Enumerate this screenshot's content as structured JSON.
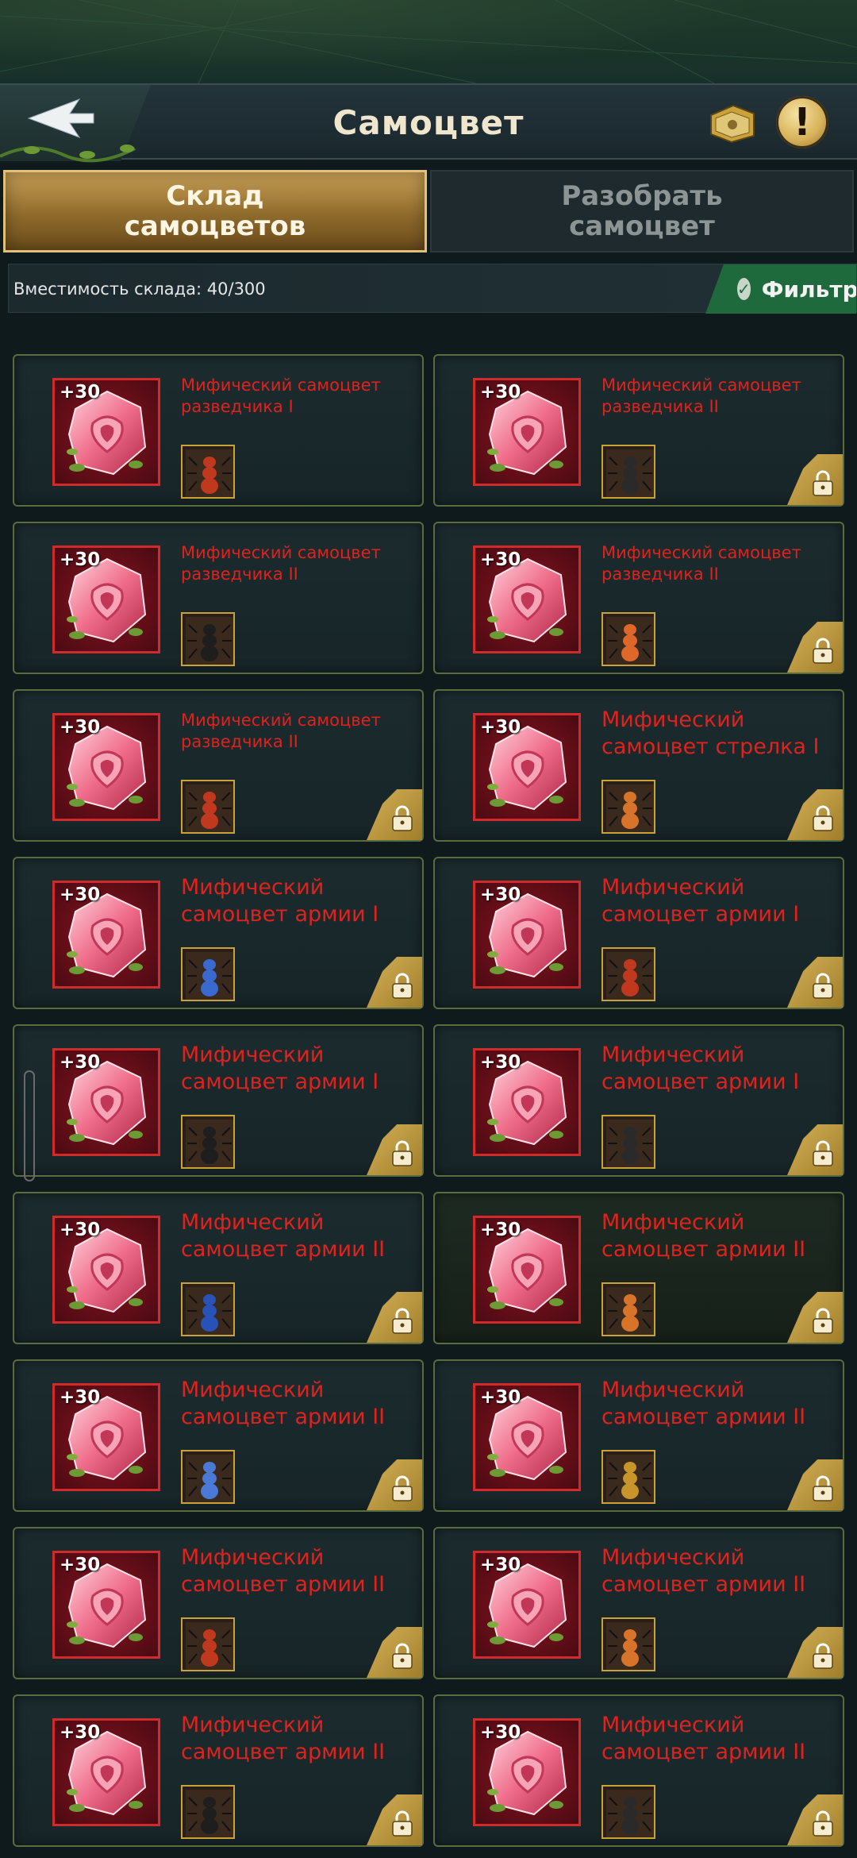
{
  "header": {
    "title": "Самоцвет"
  },
  "tabs": [
    {
      "label_line1": "Склад",
      "label_line2": "самоцветов",
      "active": true
    },
    {
      "label_line1": "Разобрать",
      "label_line2": "самоцвет",
      "active": false
    }
  ],
  "storage": {
    "capacity_text": "Вместимость склада: 40/300",
    "filter_label": "Фильтр"
  },
  "colors": {
    "accent_gold": "#c79f55",
    "gem_red": "#e0221d",
    "filter_green": "#1f6a3d"
  },
  "gems": [
    {
      "plus": "+30",
      "name": "Мифический самоцвет разведчика I",
      "size": "small",
      "locked": false,
      "unit": "ant-red"
    },
    {
      "plus": "+30",
      "name": "Мифический самоцвет разведчика II",
      "size": "small",
      "locked": true,
      "unit": "spider-black"
    },
    {
      "plus": "+30",
      "name": "Мифический самоцвет разведчика II",
      "size": "small",
      "locked": false,
      "unit": "beetle-black"
    },
    {
      "plus": "+30",
      "name": "Мифический самоцвет разведчика II",
      "size": "small",
      "locked": true,
      "unit": "ant-orange"
    },
    {
      "plus": "+30",
      "name": "Мифический самоцвет разведчика II",
      "size": "small",
      "locked": true,
      "unit": "ant-red"
    },
    {
      "plus": "+30",
      "name": "Мифический самоцвет стрелка I",
      "size": "big",
      "locked": true,
      "unit": "wasp-orange"
    },
    {
      "plus": "+30",
      "name": "Мифический самоцвет армии I",
      "size": "big",
      "locked": true,
      "unit": "ant-blue"
    },
    {
      "plus": "+30",
      "name": "Мифический самоцвет армии I",
      "size": "big",
      "locked": true,
      "unit": "ant-red"
    },
    {
      "plus": "+30",
      "name": "Мифический самоцвет армии I",
      "size": "big",
      "locked": true,
      "unit": "beetle-black"
    },
    {
      "plus": "+30",
      "name": "Мифический самоцвет армии I",
      "size": "big",
      "locked": true,
      "unit": "spider-black"
    },
    {
      "plus": "+30",
      "name": "Мифический самоцвет армии II",
      "size": "big",
      "locked": true,
      "unit": "beetle-blue"
    },
    {
      "plus": "+30",
      "name": "Мифический самоцвет армии II",
      "size": "big",
      "locked": true,
      "unit": "wasp-orange"
    },
    {
      "plus": "+30",
      "name": "Мифический самоцвет армии II",
      "size": "big",
      "locked": true,
      "unit": "mantis-blue"
    },
    {
      "plus": "+30",
      "name": "Мифический самоцвет армии II",
      "size": "big",
      "locked": true,
      "unit": "beetle-gold"
    },
    {
      "plus": "+30",
      "name": "Мифический самоцвет армии II",
      "size": "big",
      "locked": true,
      "unit": "ant-red"
    },
    {
      "plus": "+30",
      "name": "Мифический самоцвет армии II",
      "size": "big",
      "locked": true,
      "unit": "wasp-orange"
    },
    {
      "plus": "+30",
      "name": "Мифический самоцвет армии II",
      "size": "big",
      "locked": true,
      "unit": "beetle-black"
    },
    {
      "plus": "+30",
      "name": "Мифический самоцвет армии II",
      "size": "big",
      "locked": true,
      "unit": "spider-black"
    }
  ]
}
